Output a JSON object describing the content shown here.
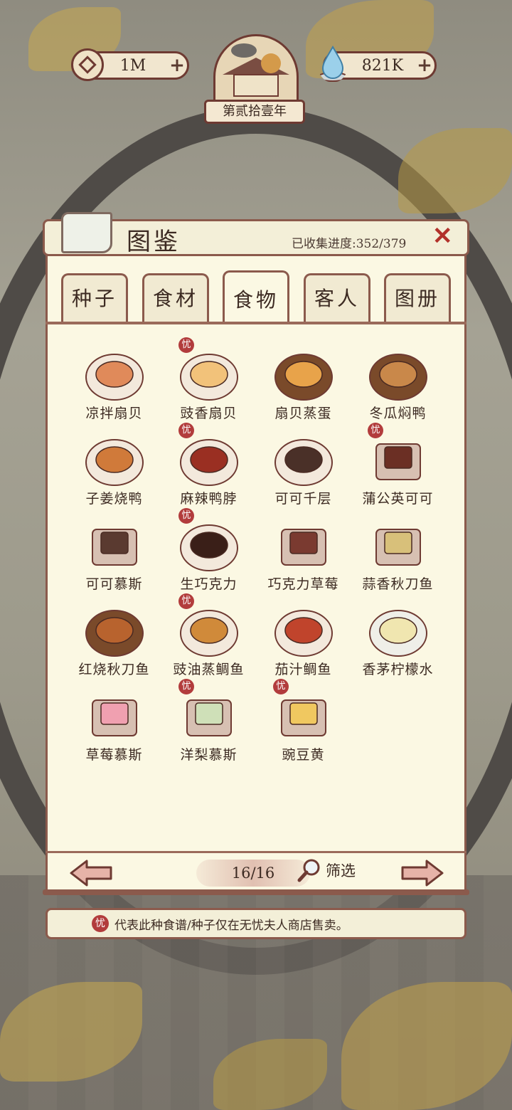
{
  "hud": {
    "coins": "1M",
    "water": "821K",
    "plus": "+",
    "year": "第贰拾壹年"
  },
  "panel": {
    "title": "图鉴",
    "progress": "已收集进度:352/379",
    "close": "✕"
  },
  "tabs": [
    {
      "label": "种子",
      "active": false
    },
    {
      "label": "食材",
      "active": false
    },
    {
      "label": "食物",
      "active": true
    },
    {
      "label": "客人",
      "active": false
    },
    {
      "label": "图册",
      "active": false
    }
  ],
  "items": [
    {
      "name": "凉拌扇贝",
      "shop_only": false
    },
    {
      "name": "豉香扇贝",
      "shop_only": true
    },
    {
      "name": "扇贝蒸蛋",
      "shop_only": false
    },
    {
      "name": "冬瓜焖鸭",
      "shop_only": false
    },
    {
      "name": "子姜烧鸭",
      "shop_only": false
    },
    {
      "name": "麻辣鸭脖",
      "shop_only": true
    },
    {
      "name": "可可千层",
      "shop_only": false
    },
    {
      "name": "蒲公英可可",
      "shop_only": true
    },
    {
      "name": "可可慕斯",
      "shop_only": false
    },
    {
      "name": "生巧克力",
      "shop_only": true
    },
    {
      "name": "巧克力草莓",
      "shop_only": false
    },
    {
      "name": "蒜香秋刀鱼",
      "shop_only": false
    },
    {
      "name": "红烧秋刀鱼",
      "shop_only": false
    },
    {
      "name": "豉油蒸鲷鱼",
      "shop_only": true
    },
    {
      "name": "茄汁鲷鱼",
      "shop_only": false
    },
    {
      "name": "香茅柠檬水",
      "shop_only": false
    },
    {
      "name": "草莓慕斯",
      "shop_only": false
    },
    {
      "name": "洋梨慕斯",
      "shop_only": true
    },
    {
      "name": "豌豆黄",
      "shop_only": true
    }
  ],
  "shop_badge": "忧",
  "pagination": {
    "page": "16/16",
    "filter_label": "筛选"
  },
  "note": {
    "badge": "忧",
    "text": "代表此种食谱/种子仅在无忧夫人商店售卖。"
  },
  "colors": {
    "panel_bg": "#fbf8e3",
    "border": "#8b5a4c",
    "shop_badge": "#b23c3c",
    "close": "#b2312a"
  }
}
